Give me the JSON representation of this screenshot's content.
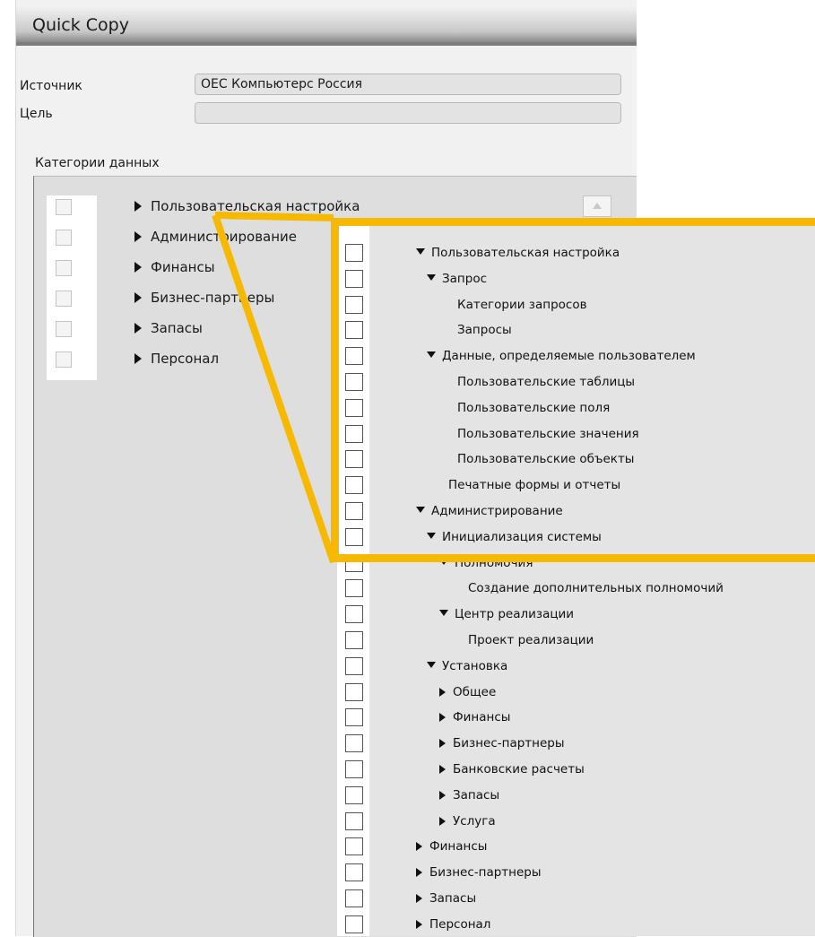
{
  "window": {
    "title": "Quick Copy"
  },
  "form": {
    "source_label": "Источник",
    "source_value": "OEC Компьютерс Россия",
    "target_label": "Цель",
    "target_value": "",
    "categories_label": "Категории данных"
  },
  "tree": {
    "rows": [
      {
        "label": "Пользовательская настройка",
        "expanded": false
      },
      {
        "label": "Администрирование",
        "expanded": false
      },
      {
        "label": "Финансы",
        "expanded": false
      },
      {
        "label": "Бизнес-партнеры",
        "expanded": false
      },
      {
        "label": "Запасы",
        "expanded": false
      },
      {
        "label": "Персонал",
        "expanded": false
      }
    ]
  },
  "zoom_tree": {
    "rows": [
      {
        "label": "Пользовательская настройка",
        "level": 0,
        "arrow": "down"
      },
      {
        "label": "Запрос",
        "level": 1,
        "arrow": "down"
      },
      {
        "label": "Категории запросов",
        "level": 2,
        "arrow": "none"
      },
      {
        "label": "Запросы",
        "level": 2,
        "arrow": "none"
      },
      {
        "label": "Данные, определяемые пользователем",
        "level": 1,
        "arrow": "down"
      },
      {
        "label": "Пользовательские таблицы",
        "level": 2,
        "arrow": "none"
      },
      {
        "label": "Пользовательские поля",
        "level": 2,
        "arrow": "none"
      },
      {
        "label": "Пользовательские значения",
        "level": 2,
        "arrow": "none"
      },
      {
        "label": "Пользовательские объекты",
        "level": 2,
        "arrow": "none"
      },
      {
        "label": "Печатные формы и отчеты",
        "level": 1,
        "arrow": "none"
      },
      {
        "label": "Администрирование",
        "level": 0,
        "arrow": "down"
      },
      {
        "label": "Инициализация системы",
        "level": 1,
        "arrow": "down"
      },
      {
        "label": "Полномочия",
        "level": 2,
        "arrow": "down"
      },
      {
        "label": "Создание дополнительных полномочий",
        "level": 3,
        "arrow": "none"
      },
      {
        "label": "Центр реализации",
        "level": 2,
        "arrow": "down"
      },
      {
        "label": "Проект реализации",
        "level": 3,
        "arrow": "none"
      },
      {
        "label": "Установка",
        "level": 1,
        "arrow": "down"
      },
      {
        "label": "Общее",
        "level": 2,
        "arrow": "right"
      },
      {
        "label": "Финансы",
        "level": 2,
        "arrow": "right"
      },
      {
        "label": "Бизнес-партнеры",
        "level": 2,
        "arrow": "right"
      },
      {
        "label": "Банковские расчеты",
        "level": 2,
        "arrow": "right"
      },
      {
        "label": "Запасы",
        "level": 2,
        "arrow": "right"
      },
      {
        "label": "Услуга",
        "level": 2,
        "arrow": "right"
      },
      {
        "label": "Финансы",
        "level": 0,
        "arrow": "right"
      },
      {
        "label": "Бизнес-партнеры",
        "level": 0,
        "arrow": "right"
      },
      {
        "label": "Запасы",
        "level": 0,
        "arrow": "right"
      },
      {
        "label": "Персонал",
        "level": 0,
        "arrow": "right"
      }
    ]
  },
  "colors": {
    "highlight": "#f7b900",
    "panel": "#f1f1f1",
    "grid": "#dedede"
  }
}
